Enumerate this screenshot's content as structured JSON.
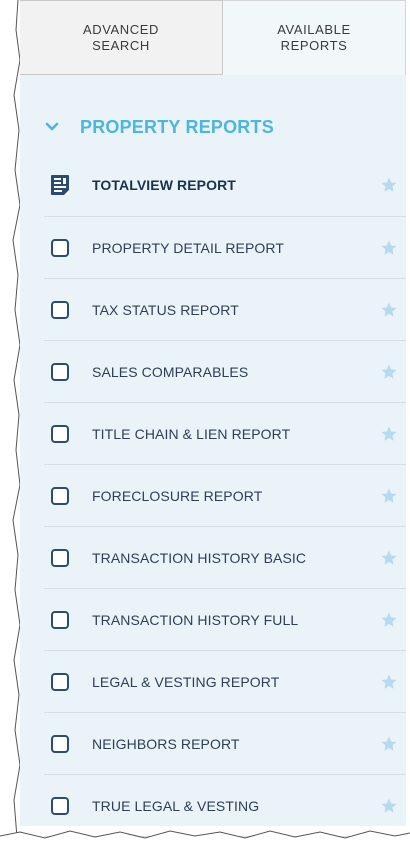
{
  "tabs": [
    {
      "line1": "ADVANCED",
      "line2": "SEARCH"
    },
    {
      "line1": "AVAILABLE",
      "line2": "REPORTS"
    }
  ],
  "section": {
    "title": "PROPERTY REPORTS",
    "expanded": true,
    "accent_color": "#4cb6e0"
  },
  "reports": [
    {
      "label": "TOTALVIEW REPORT",
      "icon": "report-document-icon"
    },
    {
      "label": "PROPERTY DETAIL REPORT",
      "icon": "checkbox"
    },
    {
      "label": "TAX STATUS REPORT",
      "icon": "checkbox"
    },
    {
      "label": "SALES COMPARABLES",
      "icon": "checkbox"
    },
    {
      "label": "TITLE CHAIN & LIEN REPORT",
      "icon": "checkbox"
    },
    {
      "label": "FORECLOSURE REPORT",
      "icon": "checkbox"
    },
    {
      "label": "TRANSACTION HISTORY BASIC",
      "icon": "checkbox"
    },
    {
      "label": "TRANSACTION HISTORY FULL",
      "icon": "checkbox"
    },
    {
      "label": "LEGAL & VESTING REPORT",
      "icon": "checkbox"
    },
    {
      "label": "NEIGHBORS REPORT",
      "icon": "checkbox"
    },
    {
      "label": "TRUE LEGAL & VESTING",
      "icon": "checkbox"
    }
  ],
  "colors": {
    "panel_bg": "#eaf3f8",
    "text": "#2d3e56",
    "checkbox_border": "#2a4b72",
    "star": "#b6daef"
  }
}
